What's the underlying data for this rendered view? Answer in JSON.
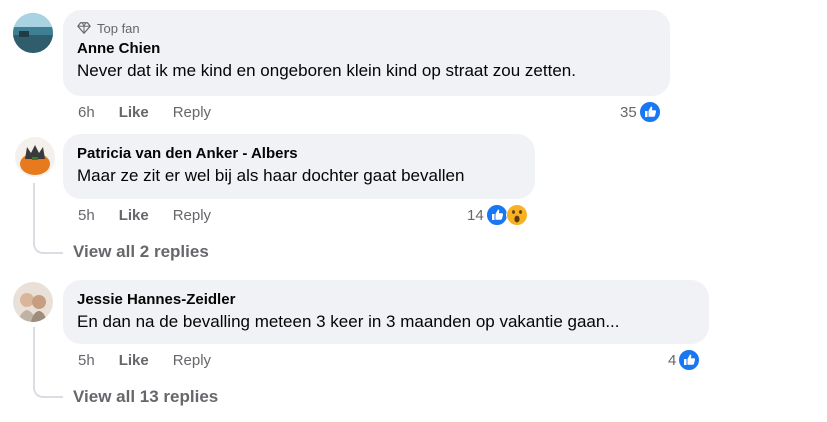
{
  "comments": [
    {
      "badge": "Top fan",
      "author": "Anne Chien",
      "text": "Never dat ik me kind en ongeboren klein kind op straat zou zetten.",
      "time": "6h",
      "like": "Like",
      "reply": "Reply",
      "reaction_count": "35",
      "reactions": [
        "like-icon"
      ]
    },
    {
      "author": "Patricia van den Anker - Albers",
      "text": "Maar ze zit er wel bij als haar dochter gaat bevallen",
      "time": "5h",
      "like": "Like",
      "reply": "Reply",
      "reaction_count": "14",
      "reactions": [
        "like-icon",
        "wow-icon"
      ],
      "view_replies": "View all 2 replies"
    },
    {
      "author": "Jessie Hannes-Zeidler",
      "text": "En dan na de bevalling meteen 3 keer in 3 maanden op vakantie gaan...",
      "time": "5h",
      "like": "Like",
      "reply": "Reply",
      "reaction_count": "4",
      "reactions": [
        "like-icon"
      ],
      "view_replies": "View all 13 replies"
    }
  ],
  "colors": {
    "bubble": "#f0f2f5",
    "secondary_text": "#65676b",
    "like_blue": "#1877f2",
    "thread_line": "#dadde1"
  }
}
